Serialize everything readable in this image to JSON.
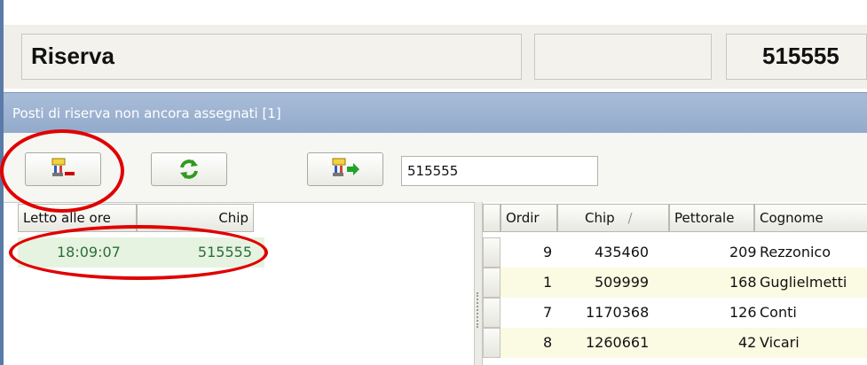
{
  "header": {
    "title": "Riserva",
    "chip_value": "515555"
  },
  "band": {
    "title": "Posti di riserva non ancora assegnati [1]"
  },
  "toolbar": {
    "buttons": [
      {
        "name": "remove-chip",
        "icon": "chip-remove-icon"
      },
      {
        "name": "refresh",
        "icon": "refresh-icon"
      },
      {
        "name": "assign-chip",
        "icon": "chip-assign-icon"
      }
    ],
    "chip_input": "515555"
  },
  "left_grid": {
    "columns": [
      "Letto alle ore",
      "Chip"
    ],
    "rows": [
      {
        "time": "18:09:07",
        "chip": "515555"
      }
    ]
  },
  "right_grid": {
    "columns": [
      "Ordir",
      "Chip",
      "Pettorale",
      "Cognome"
    ],
    "sort_indicator": "/",
    "rows": [
      {
        "order": "9",
        "chip": "435460",
        "bib": "209",
        "surname": "Rezzonico"
      },
      {
        "order": "1",
        "chip": "509999",
        "bib": "168",
        "surname": "Guglielmetti"
      },
      {
        "order": "7",
        "chip": "1170368",
        "bib": "126",
        "surname": "Conti"
      },
      {
        "order": "8",
        "chip": "1260661",
        "bib": "42",
        "surname": "Vicari"
      }
    ]
  },
  "colors": {
    "band": "#9fb4d3",
    "highlight_row": "#e6f3e1",
    "alt_row": "#fbfae2",
    "annotation": "#e00000",
    "row_text_left": "#2c6e3a"
  }
}
